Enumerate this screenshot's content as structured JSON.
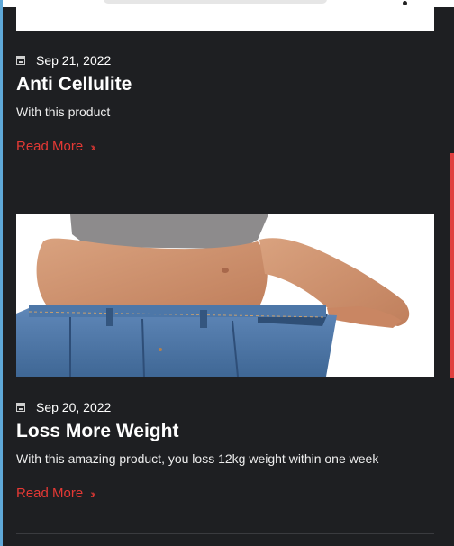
{
  "posts": [
    {
      "date": "Sep 21, 2022",
      "title": "Anti Cellulite",
      "excerpt": "With this product",
      "read_more": "Read More",
      "read_more_icon": "chevron-double-right-icon"
    },
    {
      "date": "Sep 20, 2022",
      "title": "Loss More Weight",
      "excerpt": "With this amazing product, you loss 12kg weight within one week",
      "read_more": "Read More",
      "read_more_icon": "chevron-double-right-icon",
      "image": "weight-loss-jeans-photo"
    }
  ],
  "colors": {
    "background": "#1e1f22",
    "accent": "#e53935",
    "text": "#ffffff"
  }
}
